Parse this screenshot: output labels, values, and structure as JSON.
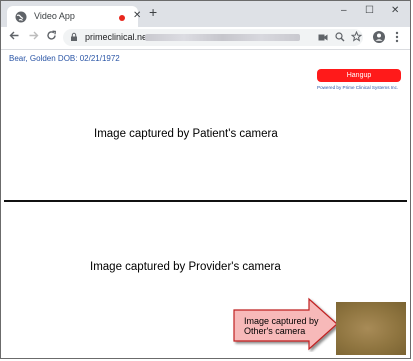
{
  "browser": {
    "tab_title": "Video App",
    "tab_close": "✕",
    "new_tab": "+",
    "window_controls": [
      "–",
      "☐",
      "✕"
    ],
    "url_prefix": "primeclinical.net",
    "nav_icons": [
      "arrow-left-icon",
      "arrow-right-icon",
      "reload-icon"
    ],
    "toolbar_icons": [
      "camera-icon",
      "zoom-icon",
      "star-icon",
      "profile-icon",
      "menu-icon"
    ]
  },
  "page": {
    "patient_info": "Bear, Golden DOB: 02/21/1972",
    "hangup_label": "Hangup",
    "powered_by": "Powered by Prime Clinical Systems Inc.",
    "patient_camera_text": "Image captured by Patient's camera",
    "provider_camera_text": "Image captured by Provider's camera",
    "other_camera_callout": [
      "Image captured by",
      "Other's camera"
    ]
  },
  "colors": {
    "hangup": "#ff1a1a",
    "link_blue": "#2a55a6",
    "recording": "#e8271d",
    "callout_pink": "#f7b9b9"
  }
}
